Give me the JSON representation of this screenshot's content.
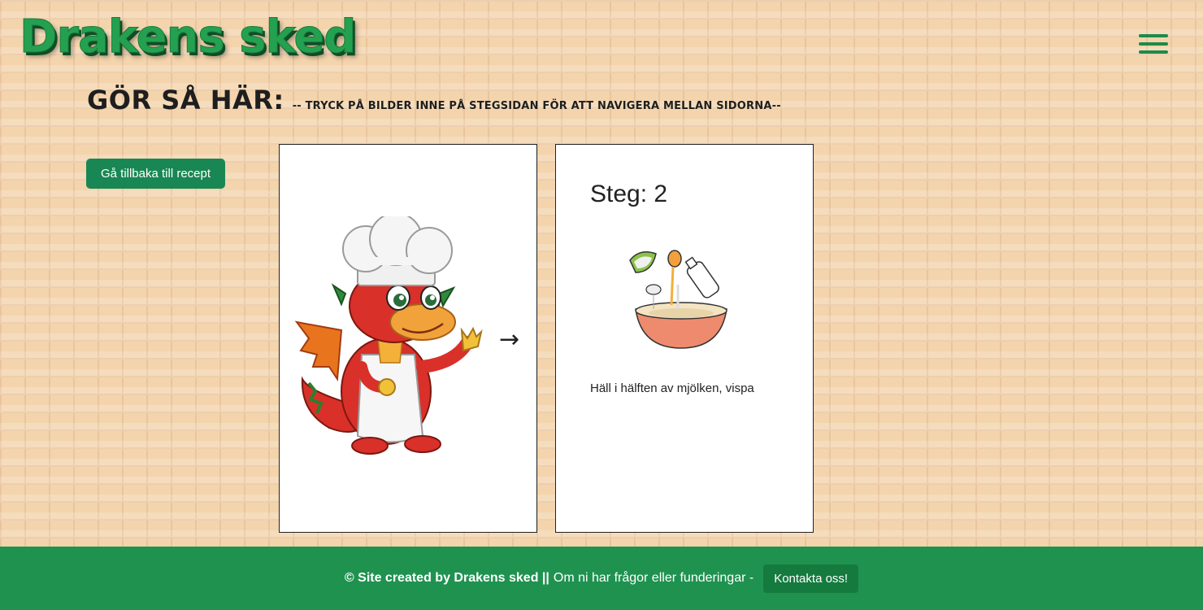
{
  "brand": {
    "logo_text": "Drakens sked"
  },
  "nav": {
    "menu_icon": "hamburger-menu-icon"
  },
  "page": {
    "heading": "GÖR SÅ HÄR:",
    "subheading": "-- tryck på bilder inne på stegsidan för att navigera mellan sidorna--",
    "back_button": "Gå tillbaka till recept"
  },
  "cards": {
    "left": {
      "image_icon": "chef-dragon-image",
      "arrow": "→"
    },
    "right": {
      "step_title": "Steg: 2",
      "image_icon": "mixing-bowl-pouring-milk-image",
      "instruction": "Häll i hälften av mjölken, vispa"
    }
  },
  "footer": {
    "credit": "© Site created by Drakens sked ||",
    "question_text": "Om ni har frågor eller funderingar -",
    "contact_button": "Kontakta oss!"
  },
  "colors": {
    "brand_green": "#198754",
    "footer_green": "#1f9250",
    "brick": "#f3d4ad"
  }
}
